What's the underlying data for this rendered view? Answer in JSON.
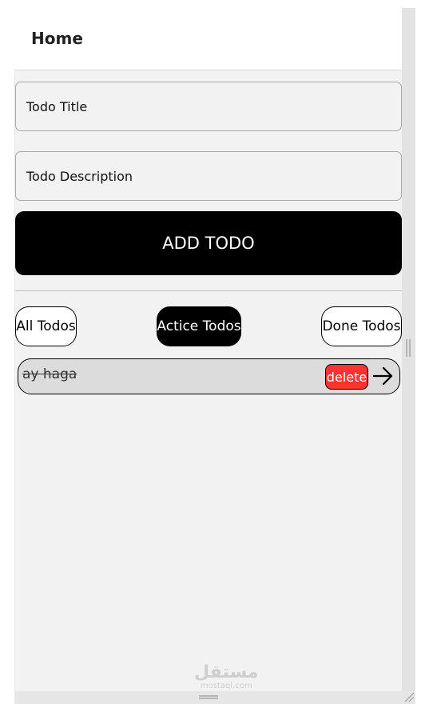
{
  "header": {
    "title": "Home"
  },
  "form": {
    "title_placeholder": "Todo Title",
    "description_placeholder": "Todo Description",
    "add_button_label": "ADD TODO"
  },
  "filters": [
    {
      "label": "All Todos",
      "active": false
    },
    {
      "label": "Actice Todos",
      "active": true
    },
    {
      "label": "Done Todos",
      "active": false
    }
  ],
  "todos": [
    {
      "title": "ay haga",
      "done": true,
      "delete_label": "delete",
      "action_icon": "arrow-right-icon"
    }
  ],
  "watermark": {
    "arabic": "مستقل",
    "latin": "mostaql.com"
  },
  "colors": {
    "accent": "#000000",
    "delete": "#ff3333",
    "background": "#f2f2f2"
  }
}
